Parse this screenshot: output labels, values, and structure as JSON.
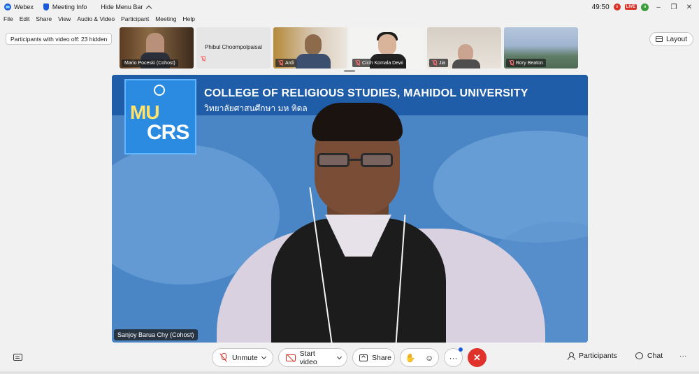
{
  "titlebar": {
    "app_name": "Webex",
    "meeting_info": "Meeting Info",
    "hide_menu_bar": "Hide Menu Bar",
    "timer": "49:50",
    "rec_letter": "o",
    "live_label": "LIVE",
    "avatar_initial": "a"
  },
  "menu": {
    "items": [
      "File",
      "Edit",
      "Share",
      "View",
      "Audio & Video",
      "Participant",
      "Meeting",
      "Help"
    ]
  },
  "video_off_label": "Participants with video off: 23 hidden",
  "layout_label": "Layout",
  "thumbnails": [
    {
      "name": "Mario Poceski (Cohost)"
    },
    {
      "name": "Phibul Choompolpaisal"
    },
    {
      "name": "Ardi"
    },
    {
      "name": "Cicih Komala Dewi"
    },
    {
      "name": "Jia"
    },
    {
      "name": "Rory Beaton"
    }
  ],
  "main_video": {
    "banner_title": "COLLEGE OF RELIGIOUS STUDIES, MAHIDOL UNIVERSITY",
    "banner_thai": "วิทยาลัยศาสนศึกษา มห        หิดล",
    "logo_mu": "MU",
    "logo_crs": "CRS",
    "speaker_name": "Sanjoy Barua Chy (Cohost)"
  },
  "toolbar": {
    "unmute": "Unmute",
    "start_video": "Start video",
    "share": "Share",
    "more": "···",
    "end": "✕",
    "participants": "Participants",
    "chat": "Chat",
    "overflow": "···"
  }
}
